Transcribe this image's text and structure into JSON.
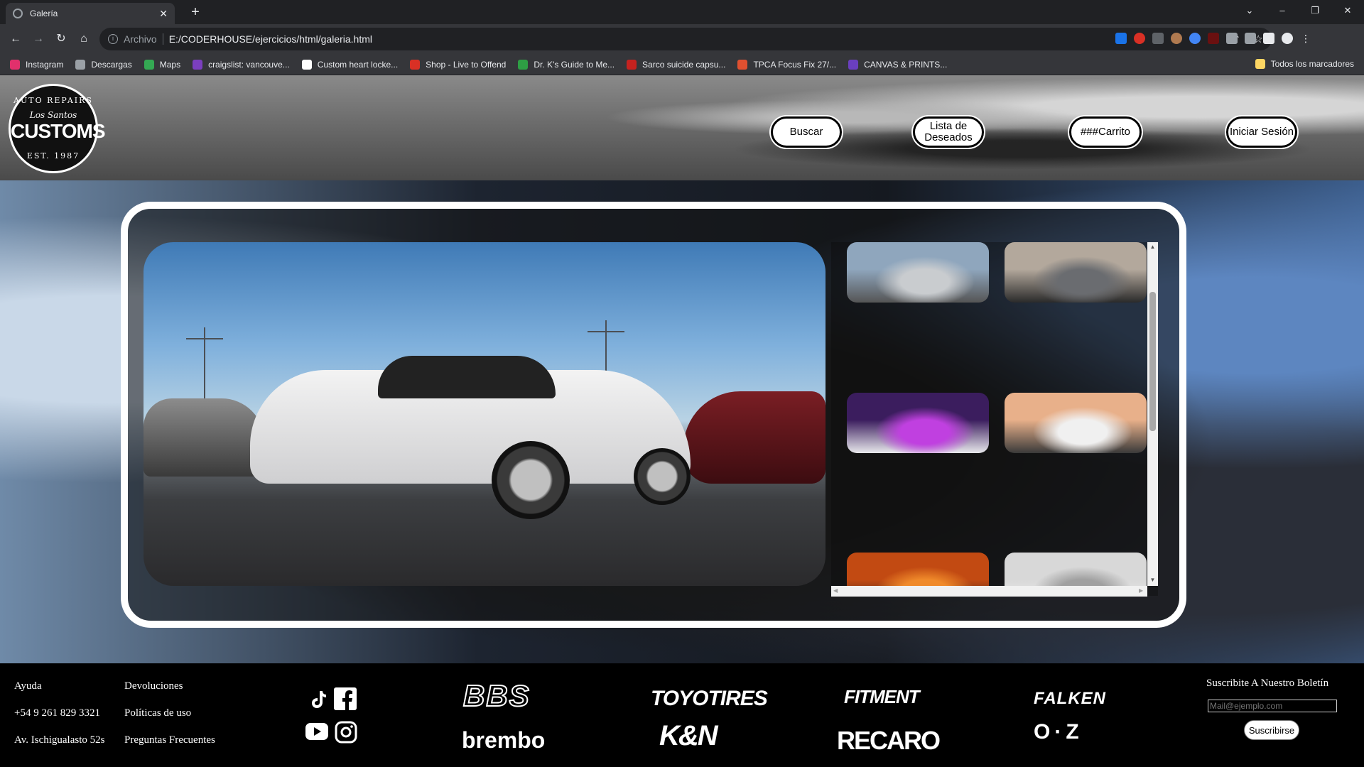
{
  "browser": {
    "tab_title": "Galería",
    "new_tab_symbol": "+",
    "omnibox": {
      "scheme_label": "Archivo",
      "url": "E:/CODERHOUSE/ejercicios/html/galeria.html"
    },
    "bookmarks": [
      {
        "label": "Instagram",
        "color": "#e1306c"
      },
      {
        "label": "Descargas",
        "color": "#9aa0a6"
      },
      {
        "label": "Maps",
        "color": "#34a853"
      },
      {
        "label": "craigslist: vancouve...",
        "color": "#7b3fbf"
      },
      {
        "label": "Custom heart locke...",
        "color": "#ffffff"
      },
      {
        "label": "Shop - Live to Offend",
        "color": "#d93025"
      },
      {
        "label": "Dr. K's Guide to Me...",
        "color": "#2e9e44"
      },
      {
        "label": "Sarco suicide capsu...",
        "color": "#c5221f"
      },
      {
        "label": "TPCA Focus Fix 27/...",
        "color": "#e05030"
      },
      {
        "label": "CANVAS & PRINTS...",
        "color": "#6a3fbf"
      }
    ],
    "all_bookmarks_label": "Todos los marcadores"
  },
  "header": {
    "logo": {
      "top_text": "AUTO REPAIRS",
      "script_text": "Los Santos",
      "main_text": "CUSTOMS",
      "bottom_text": "EST. 1987"
    },
    "buttons": {
      "search": "Buscar",
      "wishlist_line1": "Lista de",
      "wishlist_line2": "Deseados",
      "cart": "###Carrito",
      "login": "Iniciar Sesión"
    }
  },
  "gallery": {
    "thumbnails": [
      {
        "name": "thumb-silver-supercar-row",
        "palette": [
          "#8fa6bd",
          "#c9cccf",
          "#555"
        ]
      },
      {
        "name": "thumb-grey-widebody-street",
        "palette": [
          "#b3a89c",
          "#6a6c70",
          "#2a2a2a"
        ]
      },
      {
        "name": "thumb-white-coupe-neon",
        "palette": [
          "#3b1d5e",
          "#c040e0",
          "#e8e8ec"
        ]
      },
      {
        "name": "thumb-white-gtr-sunset",
        "palette": [
          "#e8b08a",
          "#f0f0f0",
          "#3a3a3a"
        ]
      },
      {
        "name": "thumb-garage-orange",
        "palette": [
          "#c24a12",
          "#f08a2a",
          "#1a1a1a"
        ]
      },
      {
        "name": "thumb-white-car-showroom",
        "palette": [
          "#d8d8d8",
          "#a0a0a0",
          "#f2f2f2"
        ]
      }
    ]
  },
  "footer": {
    "col1": [
      "Ayuda",
      "+54 9 261 829 3321",
      "Av. Ischigualasto 52s"
    ],
    "col2": [
      "Devoluciones",
      "Políticas de uso",
      "Preguntas Frecuentes"
    ],
    "social_icons": [
      "tiktok-icon",
      "facebook-icon",
      "youtube-icon",
      "instagram-icon"
    ],
    "brands": [
      "BBS",
      "TOYOTIRES",
      "FITMENT",
      "FALKEN",
      "brembo",
      "K&N",
      "RECARO",
      "O·Z"
    ],
    "newsletter": {
      "title": "Suscribite A Nuestro Boletín",
      "placeholder": "Mail@ejemplo.com",
      "button": "Suscribirse"
    }
  }
}
